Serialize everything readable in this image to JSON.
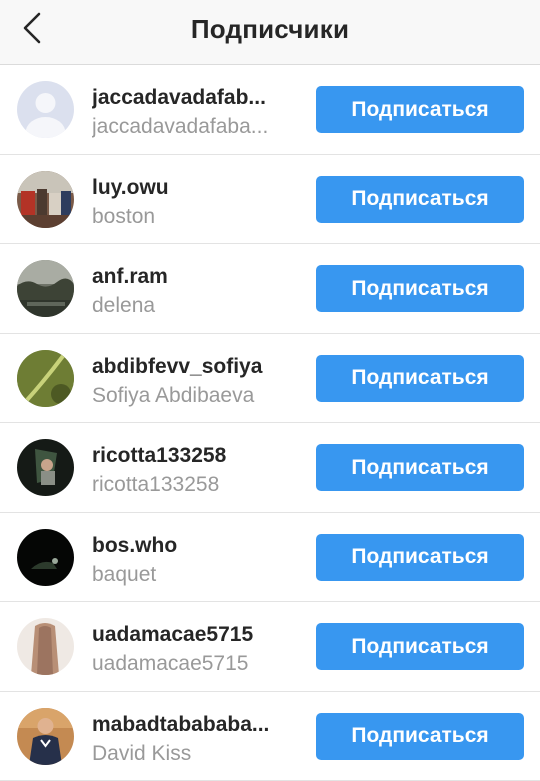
{
  "header": {
    "title": "Подписчики",
    "back_icon": "chevron-left-icon"
  },
  "colors": {
    "button_bg": "#3897f0",
    "button_text": "#ffffff",
    "secondary_text": "#999999",
    "primary_text": "#262626"
  },
  "follow_label": "Подписаться",
  "followers": [
    {
      "username": "jaccadavadafab...",
      "name": "jaccadavadafaba...",
      "avatar": "default-avatar-icon"
    },
    {
      "username": "luy.owu",
      "name": "boston",
      "avatar": "photo-avatar"
    },
    {
      "username": "anf.ram",
      "name": "delena",
      "avatar": "photo-avatar"
    },
    {
      "username": "abdibfevv_sofiya",
      "name": "Sofiya Abdibaeva",
      "avatar": "photo-avatar"
    },
    {
      "username": "ricotta133258",
      "name": "ricotta133258",
      "avatar": "photo-avatar"
    },
    {
      "username": "bos.who",
      "name": "baquet",
      "avatar": "photo-avatar"
    },
    {
      "username": "uadamacae5715",
      "name": "uadamacae5715",
      "avatar": "photo-avatar"
    },
    {
      "username": "mabadtabababa...",
      "name": "David Kiss",
      "avatar": "photo-avatar"
    }
  ]
}
